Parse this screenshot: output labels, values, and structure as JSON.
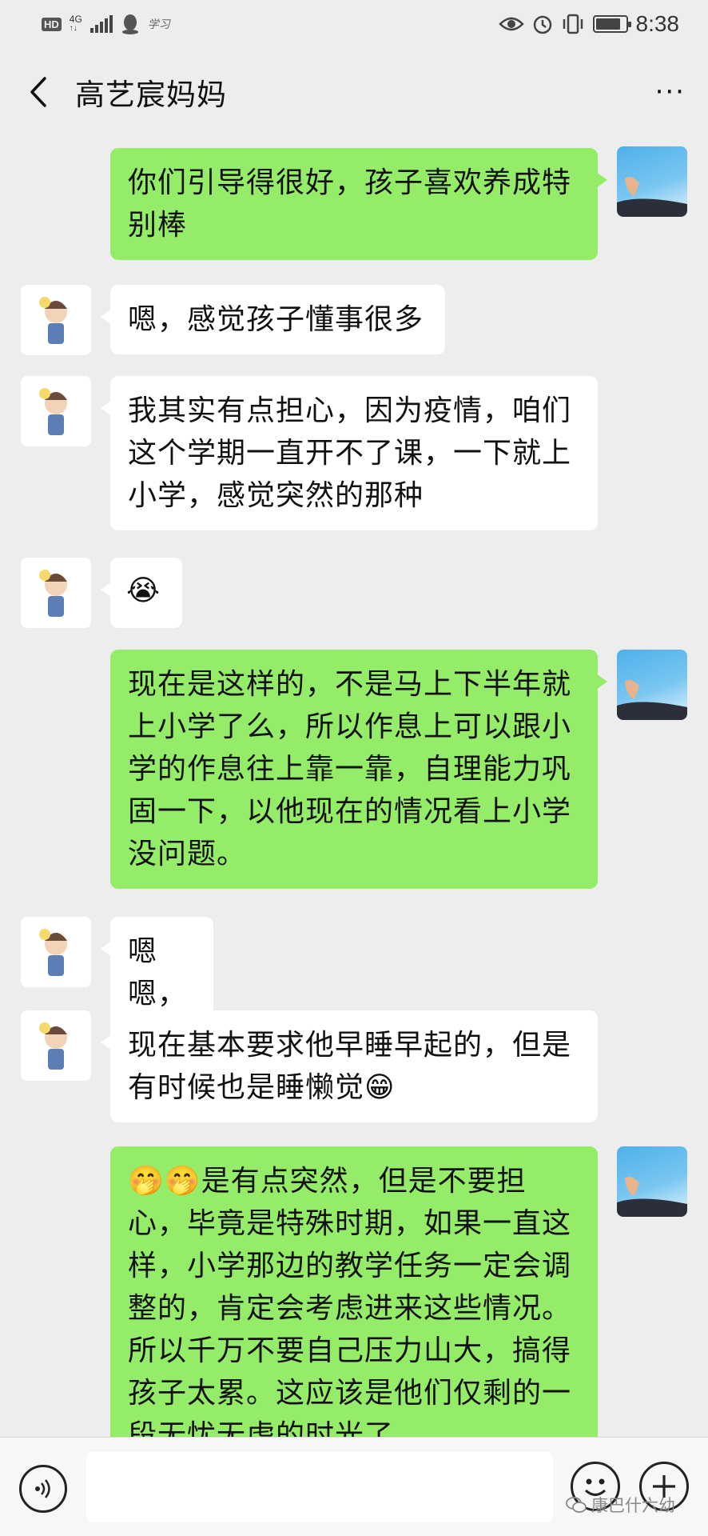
{
  "status_bar": {
    "hd": "HD",
    "network": "4G",
    "app_hint": "学习",
    "time": "8:38",
    "battery_level": 0.85
  },
  "header": {
    "title": "高艺宸妈妈",
    "more": "···"
  },
  "messages": [
    {
      "side": "right",
      "text": "你们引导得很好，孩子喜欢养成特别棒"
    },
    {
      "side": "left",
      "text": "嗯，感觉孩子懂事很多"
    },
    {
      "side": "left",
      "text": "我其实有点担心，因为疫情，咱们这个学期一直开不了课，一下就上小学，感觉突然的那种"
    },
    {
      "side": "left",
      "text": "😭"
    },
    {
      "side": "right",
      "text": "现在是这样的，不是马上下半年就上小学了么，所以作息上可以跟小学的作息往上靠一靠，自理能力巩固一下，以他现在的情况看上小学没问题。"
    },
    {
      "side": "left",
      "text": "嗯嗯，"
    },
    {
      "side": "left",
      "text": "现在基本要求他早睡早起的，但是有时候也是睡懒觉😁"
    },
    {
      "side": "right",
      "text": "🤭🤭是有点突然，但是不要担心，毕竟是特殊时期，如果一直这样，小学那边的教学任务一定会调整的，肯定会考虑进来这些情况。所以千万不要自己压力山大，搞得孩子太累。这应该是他们仅剩的一段无忧无虑的时光了"
    }
  ],
  "watermark": "康巴什六幼",
  "colors": {
    "background": "#ededed",
    "bubble_sent": "#95ec69",
    "bubble_received": "#ffffff"
  }
}
